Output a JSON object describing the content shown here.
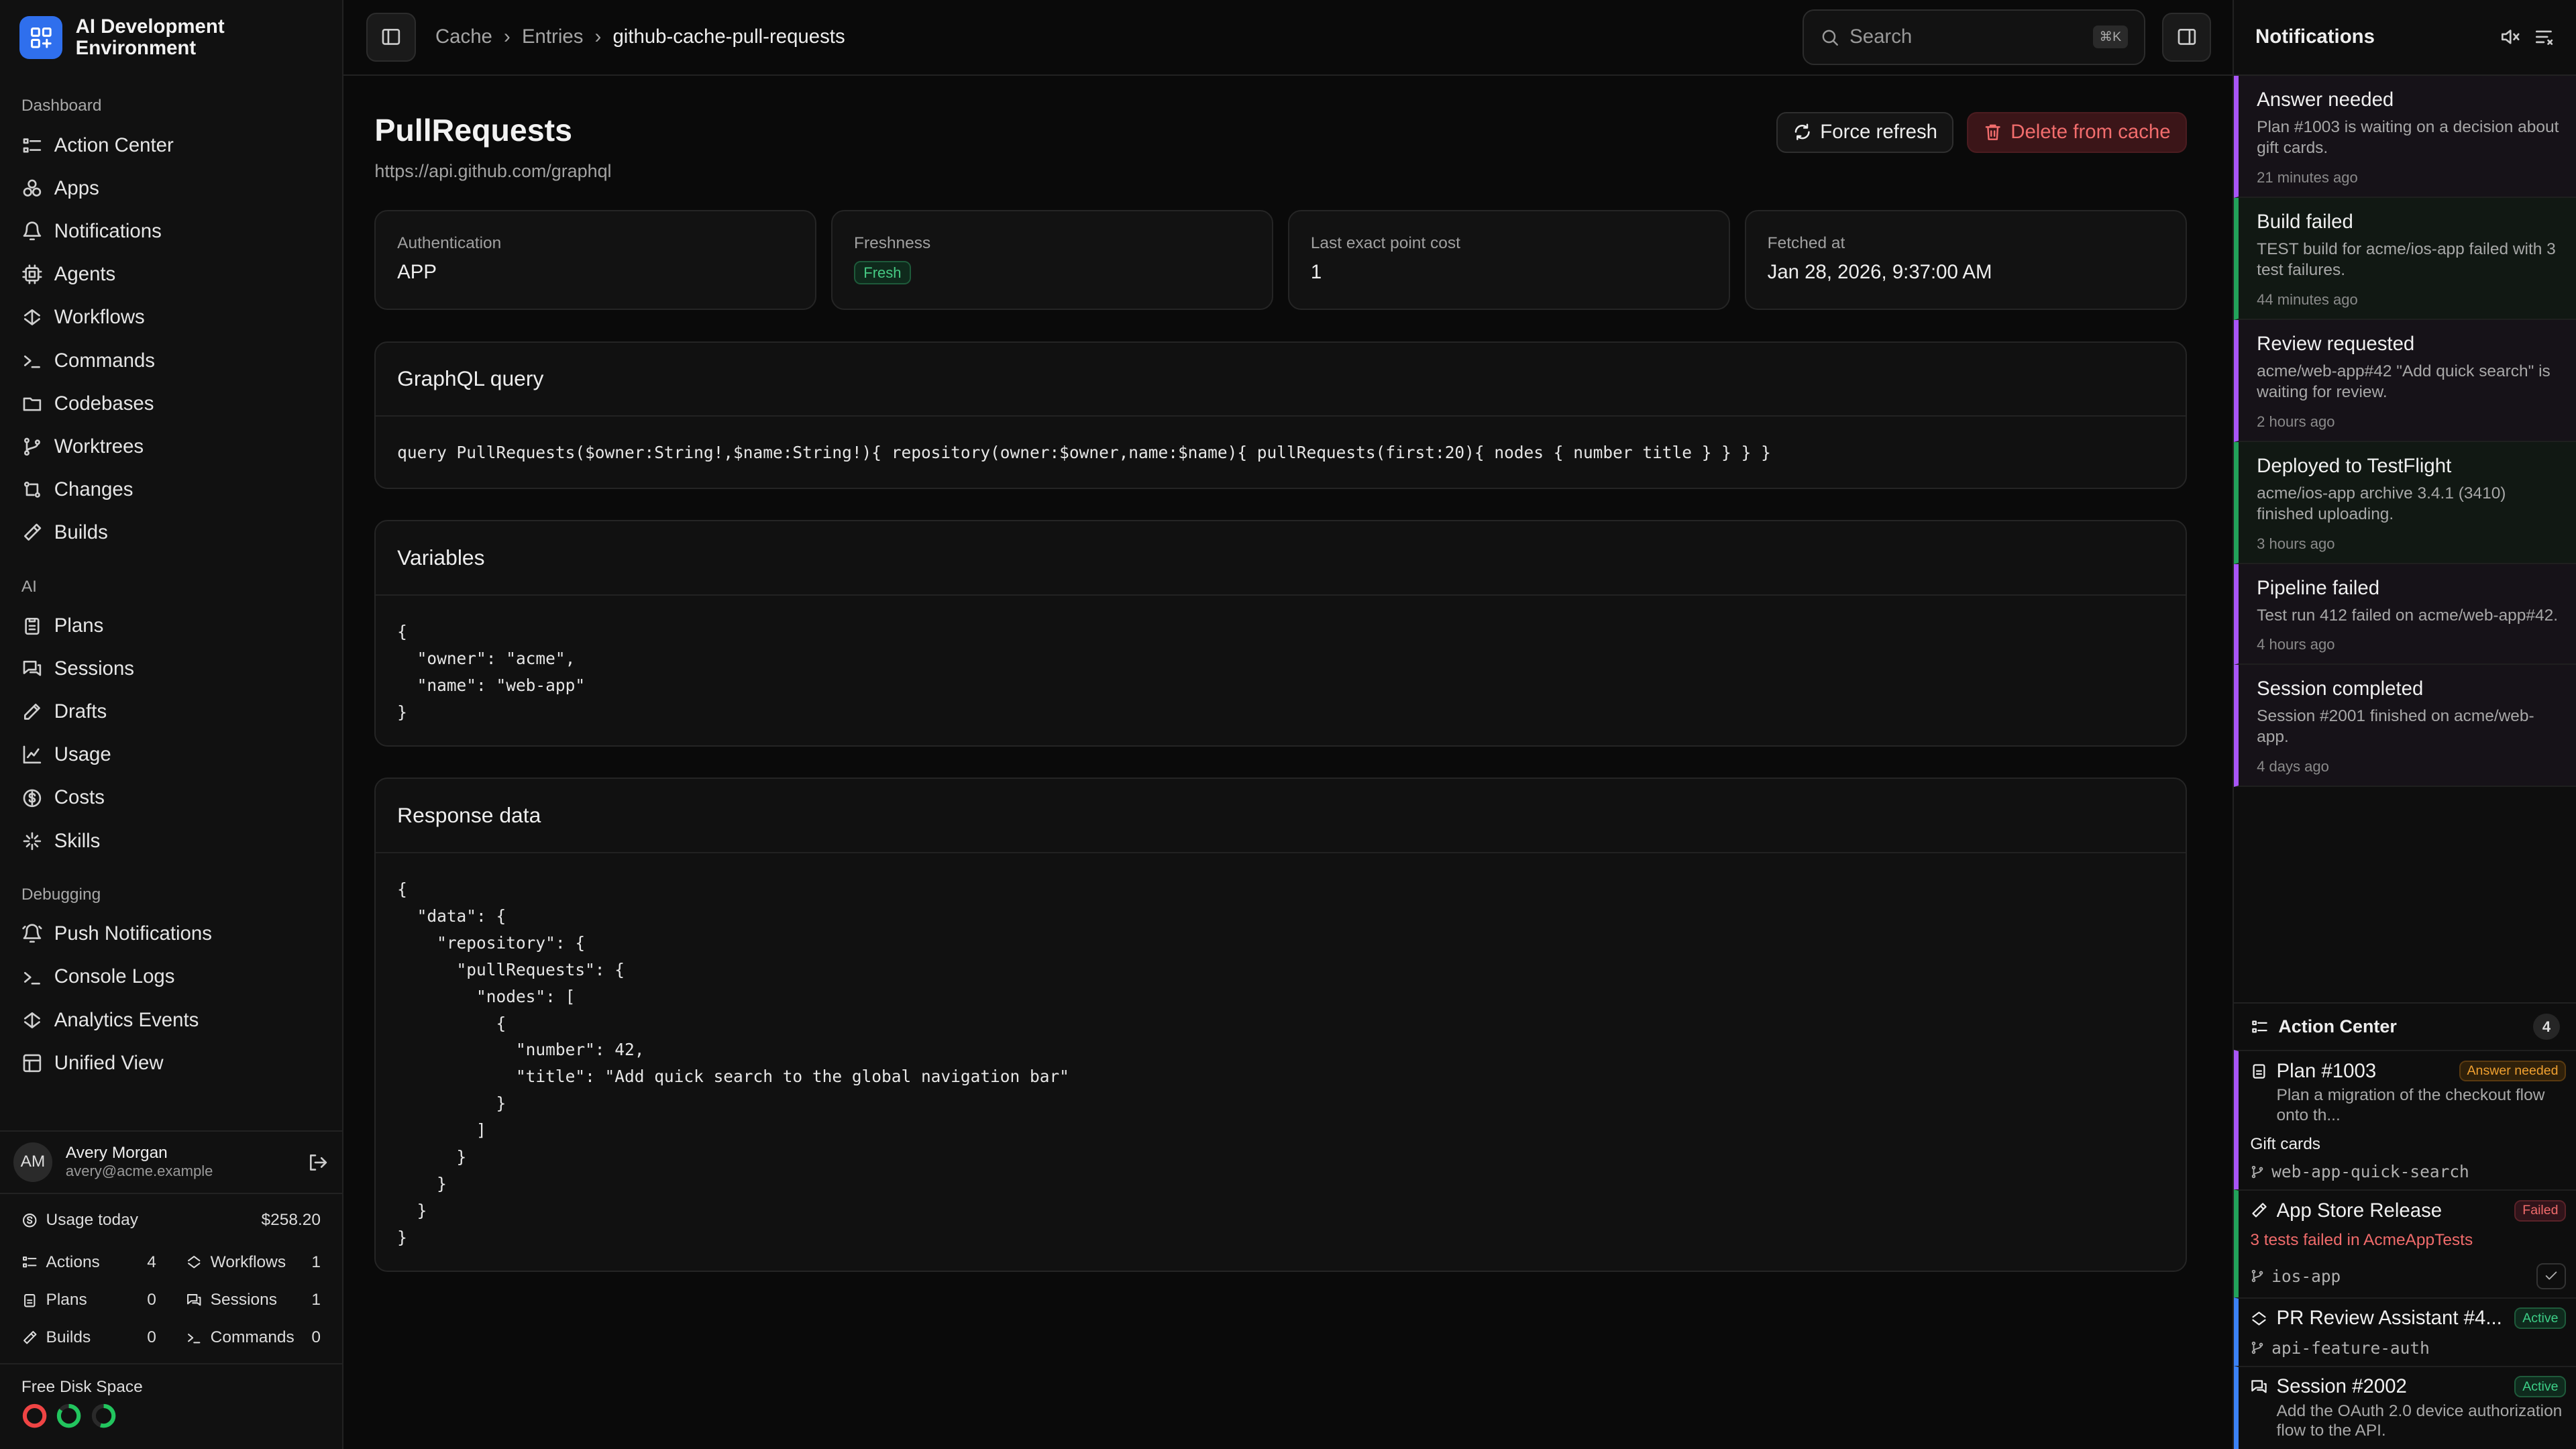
{
  "app": {
    "title": "AI Development Environment"
  },
  "sidebar": {
    "groups": [
      {
        "label": "Dashboard",
        "items": [
          {
            "label": "Action Center",
            "icon": "list-icon"
          },
          {
            "label": "Apps",
            "icon": "apps-icon"
          },
          {
            "label": "Notifications",
            "icon": "bell-icon"
          },
          {
            "label": "Agents",
            "icon": "cpu-icon"
          },
          {
            "label": "Workflows",
            "icon": "workflow-icon"
          },
          {
            "label": "Commands",
            "icon": "terminal-icon"
          },
          {
            "label": "Codebases",
            "icon": "folder-icon"
          },
          {
            "label": "Worktrees",
            "icon": "branch-icon"
          },
          {
            "label": "Changes",
            "icon": "diff-icon"
          },
          {
            "label": "Builds",
            "icon": "hammer-icon"
          }
        ]
      },
      {
        "label": "AI",
        "items": [
          {
            "label": "Plans",
            "icon": "clipboard-icon"
          },
          {
            "label": "Sessions",
            "icon": "chat-icon"
          },
          {
            "label": "Drafts",
            "icon": "edit-icon"
          },
          {
            "label": "Usage",
            "icon": "chart-icon"
          },
          {
            "label": "Costs",
            "icon": "dollar-icon"
          },
          {
            "label": "Skills",
            "icon": "sparkle-icon"
          }
        ]
      },
      {
        "label": "Debugging",
        "items": [
          {
            "label": "Push Notifications",
            "icon": "bell-ring-icon"
          },
          {
            "label": "Console Logs",
            "icon": "terminal-icon"
          },
          {
            "label": "Analytics Events",
            "icon": "analytics-icon"
          },
          {
            "label": "Unified View",
            "icon": "layout-icon"
          }
        ]
      }
    ],
    "user": {
      "initials": "AM",
      "name": "Avery Morgan",
      "email": "avery@acme.example"
    },
    "usage": {
      "label": "Usage today",
      "amount": "$258.20",
      "stats": [
        {
          "label": "Actions",
          "value": "4"
        },
        {
          "label": "Workflows",
          "value": "1"
        },
        {
          "label": "Plans",
          "value": "0"
        },
        {
          "label": "Sessions",
          "value": "1"
        },
        {
          "label": "Builds",
          "value": "0"
        },
        {
          "label": "Commands",
          "value": "0"
        }
      ]
    },
    "disk": {
      "label": "Free Disk Space",
      "rings": [
        {
          "color": "#ef4444",
          "fraction": 1.0
        },
        {
          "color": "#22c55e",
          "fraction": 0.85
        },
        {
          "color": "#22c55e",
          "fraction": 0.55
        }
      ]
    }
  },
  "topbar": {
    "breadcrumbs": [
      "Cache",
      "Entries",
      "github-cache-pull-requests"
    ],
    "search_placeholder": "Search",
    "search_kbd": "⌘K"
  },
  "entry": {
    "title": "PullRequests",
    "url": "https://api.github.com/graphql",
    "refresh_label": "Force refresh",
    "delete_label": "Delete from cache",
    "stats": [
      {
        "key": "Authentication",
        "value": "APP"
      },
      {
        "key": "Freshness",
        "value": "Fresh"
      },
      {
        "key": "Last exact point cost",
        "value": "1"
      },
      {
        "key": "Fetched at",
        "value": "Jan 28, 2026, 9:37:00 AM"
      }
    ],
    "query_title": "GraphQL query",
    "query": "query PullRequests($owner:String!,$name:String!){ repository(owner:$owner,name:$name){ pullRequests(first:20){ nodes { number title } } } }",
    "variables_title": "Variables",
    "variables": "{\n  \"owner\": \"acme\",\n  \"name\": \"web-app\"\n}",
    "response_title": "Response data",
    "response": "{\n  \"data\": {\n    \"repository\": {\n      \"pullRequests\": {\n        \"nodes\": [\n          {\n            \"number\": 42,\n            \"title\": \"Add quick search to the global navigation bar\"\n          }\n        ]\n      }\n    }\n  }\n}"
  },
  "notifications": {
    "title": "Notifications",
    "items": [
      {
        "title": "Answer needed",
        "desc": "Plan #1003 is waiting on a decision about gift cards.",
        "time": "21 minutes ago",
        "tone": "purple"
      },
      {
        "title": "Build failed",
        "desc": "TEST build for acme/ios-app failed with 3 test failures.",
        "time": "44 minutes ago",
        "tone": "green"
      },
      {
        "title": "Review requested",
        "desc": "acme/web-app#42 \"Add quick search\" is waiting for review.",
        "time": "2 hours ago",
        "tone": "purple"
      },
      {
        "title": "Deployed to TestFlight",
        "desc": "acme/ios-app archive 3.4.1 (3410) finished uploading.",
        "time": "3 hours ago",
        "tone": "green"
      },
      {
        "title": "Pipeline failed",
        "desc": "Test run 412 failed on acme/web-app#42.",
        "time": "4 hours ago",
        "tone": "purple"
      },
      {
        "title": "Session completed",
        "desc": "Session #2001 finished on acme/web-app.",
        "time": "4 days ago",
        "tone": "purple"
      }
    ]
  },
  "action_center": {
    "title": "Action Center",
    "count": "4",
    "items": [
      {
        "title": "Plan #1003",
        "badge": "Answer needed",
        "desc": "Plan a migration of the checkout flow onto th...",
        "extra": "Gift cards",
        "branch": "web-app-quick-search"
      },
      {
        "title": "App Store Release",
        "badge": "Failed",
        "desc": "3 tests failed in AcmeAppTests",
        "branch": "ios-app"
      },
      {
        "title": "PR Review Assistant #4...",
        "badge": "Active",
        "branch": "api-feature-auth"
      },
      {
        "title": "Session #2002",
        "badge": "Active",
        "desc": "Add the OAuth 2.0 device authorization flow to the API."
      }
    ]
  }
}
